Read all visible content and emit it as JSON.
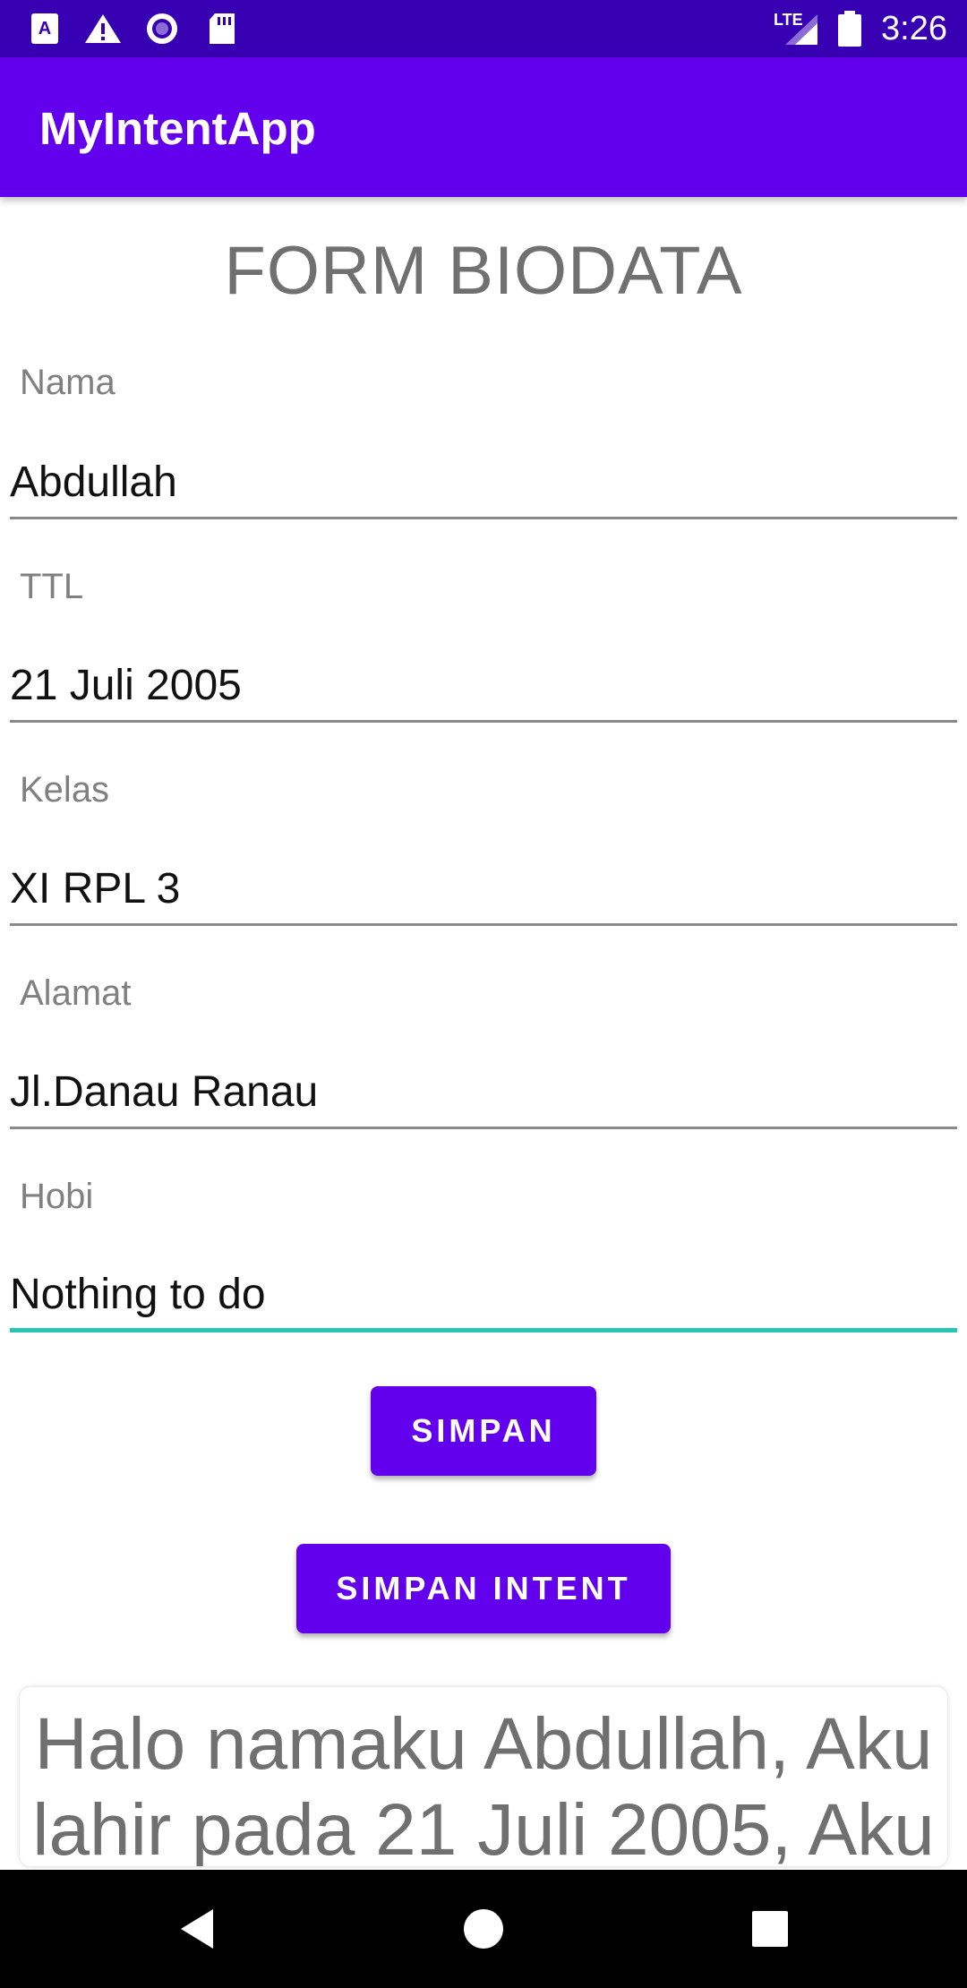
{
  "status_bar": {
    "time": "3:26",
    "network": "LTE",
    "icons": [
      "accessibility-icon",
      "warning-icon",
      "record-icon",
      "sd-card-icon",
      "signal-icon",
      "battery-icon"
    ]
  },
  "app_bar": {
    "title": "MyIntentApp"
  },
  "form": {
    "title": "FORM BIODATA",
    "fields": [
      {
        "label": "Nama",
        "value": "Abdullah"
      },
      {
        "label": "TTL",
        "value": "21 Juli 2005"
      },
      {
        "label": "Kelas",
        "value": "XI RPL 3"
      },
      {
        "label": "Alamat",
        "value": "Jl.Danau Ranau"
      },
      {
        "label": "Hobi",
        "value": "Nothing to do"
      }
    ],
    "save_label": "SIMPAN",
    "save_intent_label": "SIMPAN INTENT"
  },
  "result": {
    "text": "Halo namaku Abdullah, Aku lahir pada 21 Juli 2005, Aku"
  },
  "nav": {
    "icons": [
      "back-icon",
      "home-icon",
      "recents-icon"
    ]
  },
  "colors": {
    "primary": "#6200ee",
    "primary_dark": "#3700b3",
    "accent": "#26c6b0"
  }
}
